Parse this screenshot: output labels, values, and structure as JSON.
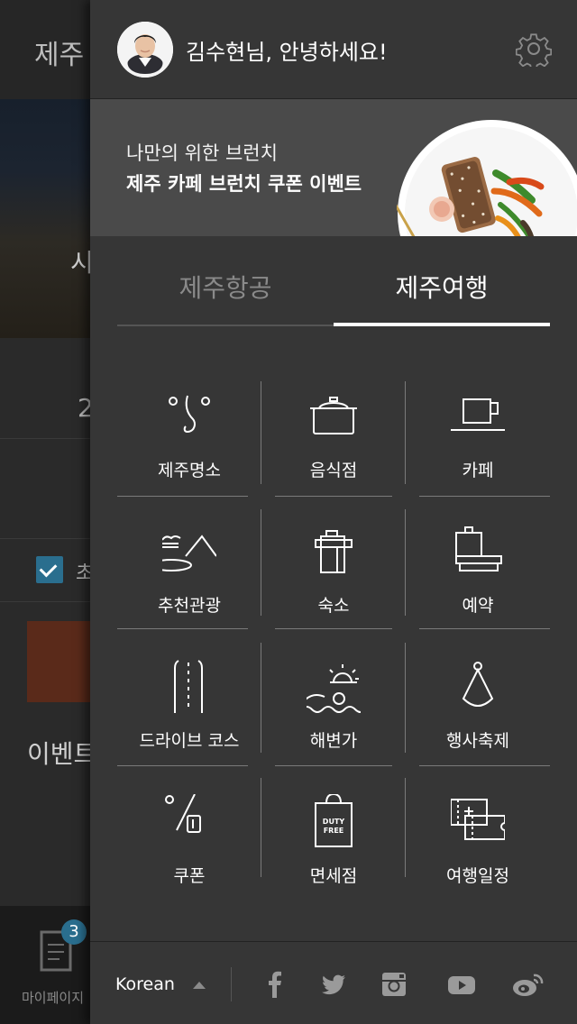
{
  "background": {
    "title": "제주",
    "hero_text": "시",
    "number": "2",
    "checkbox_label": "초",
    "event_label": "이벤트",
    "badge_count": "3",
    "mypage_label": "마이페이지"
  },
  "drawer": {
    "greeting": "김수현님, 안녕하세요!",
    "banner": {
      "subtitle": "나만의 위한 브런치",
      "title": "제주 카페 브런치 쿠폰 이벤트"
    },
    "tabs": [
      {
        "label": "제주항공",
        "active": false
      },
      {
        "label": "제주여행",
        "active": true
      }
    ],
    "menu": [
      {
        "label": "제주명소",
        "icon": "landmark-icon"
      },
      {
        "label": "음식점",
        "icon": "pot-icon"
      },
      {
        "label": "카페",
        "icon": "coffee-cup-icon"
      },
      {
        "label": "추천관광",
        "icon": "mountain-lake-icon"
      },
      {
        "label": "숙소",
        "icon": "luggage-icon"
      },
      {
        "label": "예약",
        "icon": "reservation-icon"
      },
      {
        "label": "드라이브 코스",
        "icon": "road-icon"
      },
      {
        "label": "해변가",
        "icon": "beach-sun-icon"
      },
      {
        "label": "행사축제",
        "icon": "party-hat-icon"
      },
      {
        "label": "쿠폰",
        "icon": "percent-coupon-icon"
      },
      {
        "label": "면세점",
        "icon": "duty-free-bag-icon"
      },
      {
        "label": "여행일정",
        "icon": "tickets-icon"
      }
    ],
    "duty_free_text": [
      "DUTY",
      "FREE"
    ],
    "footer": {
      "language": "Korean",
      "social": [
        "facebook-icon",
        "twitter-icon",
        "instagram-icon",
        "youtube-icon",
        "weibo-icon"
      ]
    }
  },
  "colors": {
    "drawer_bg": "#363636",
    "banner_bg": "#4a4a4a",
    "accent": "#2a6e8e",
    "inactive_tab": "#8a8a8a"
  }
}
